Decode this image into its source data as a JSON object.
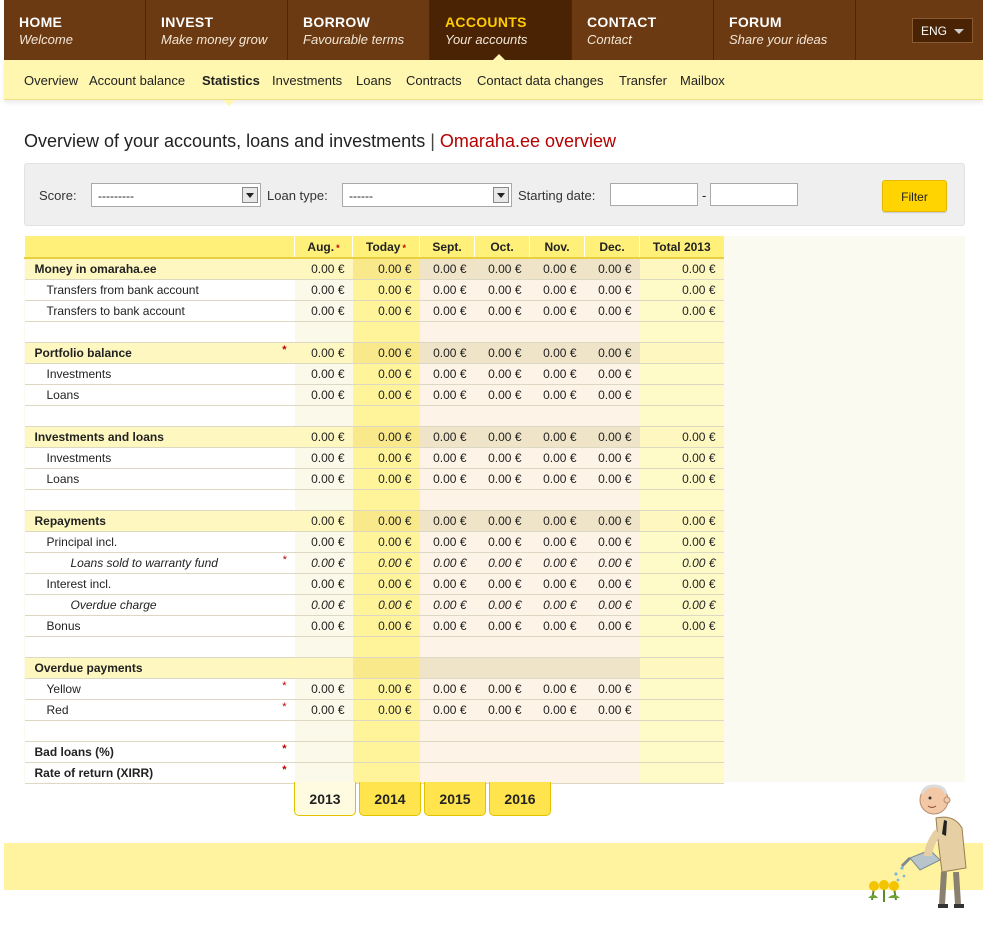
{
  "topnav": [
    {
      "title": "HOME",
      "subtitle": "Welcome"
    },
    {
      "title": "INVEST",
      "subtitle": "Make money grow"
    },
    {
      "title": "BORROW",
      "subtitle": "Favourable terms"
    },
    {
      "title": "ACCOUNTS",
      "subtitle": "Your accounts"
    },
    {
      "title": "CONTACT",
      "subtitle": "Contact"
    },
    {
      "title": "FORUM",
      "subtitle": "Share your ideas"
    }
  ],
  "language": "ENG",
  "subnav": [
    "Overview",
    "Account balance",
    "Statistics",
    "Investments",
    "Loans",
    "Contracts",
    "Contact data changes",
    "Transfer",
    "Mailbox"
  ],
  "page": {
    "title": "Overview of your accounts, loans and investments",
    "separator": "|",
    "brand": "Omaraha.ee overview"
  },
  "filter": {
    "score_label": "Score:",
    "score_value": "---------",
    "loan_type_label": "Loan type:",
    "loan_type_value": "------",
    "start_label": "Starting date:",
    "date_from": "",
    "date_to": "",
    "dash": "-",
    "button": "Filter"
  },
  "table": {
    "columns": [
      "Aug.",
      "Today",
      "Sept.",
      "Oct.",
      "Nov.",
      "Dec.",
      "Total 2013"
    ],
    "required_mark": "*",
    "rows": [
      {
        "label": "Money in omaraha.ee",
        "kind": "sect",
        "values": [
          "0.00 €",
          "0.00 €",
          "0.00 €",
          "0.00 €",
          "0.00 €",
          "0.00 €",
          "0.00 €"
        ]
      },
      {
        "label": "Transfers from bank account",
        "kind": "sub",
        "values": [
          "0.00 €",
          "0.00 €",
          "0.00 €",
          "0.00 €",
          "0.00 €",
          "0.00 €",
          "0.00 €"
        ]
      },
      {
        "label": "Transfers to bank account",
        "kind": "sub",
        "values": [
          "0.00 €",
          "0.00 €",
          "0.00 €",
          "0.00 €",
          "0.00 €",
          "0.00 €",
          "0.00 €"
        ]
      },
      {
        "label": "",
        "kind": "blank",
        "values": [
          "",
          "",
          "",
          "",
          "",
          "",
          ""
        ]
      },
      {
        "label": "Portfolio balance",
        "kind": "sect",
        "req": "*",
        "values": [
          "0.00 €",
          "0.00 €",
          "0.00 €",
          "0.00 €",
          "0.00 €",
          "0.00 €",
          ""
        ]
      },
      {
        "label": "Investments",
        "kind": "sub",
        "values": [
          "0.00 €",
          "0.00 €",
          "0.00 €",
          "0.00 €",
          "0.00 €",
          "0.00 €",
          ""
        ]
      },
      {
        "label": "Loans",
        "kind": "sub",
        "values": [
          "0.00 €",
          "0.00 €",
          "0.00 €",
          "0.00 €",
          "0.00 €",
          "0.00 €",
          ""
        ]
      },
      {
        "label": "",
        "kind": "blank",
        "values": [
          "",
          "",
          "",
          "",
          "",
          "",
          ""
        ]
      },
      {
        "label": "Investments and loans",
        "kind": "sect",
        "values": [
          "0.00 €",
          "0.00 €",
          "0.00 €",
          "0.00 €",
          "0.00 €",
          "0.00 €",
          "0.00 €"
        ]
      },
      {
        "label": "Investments",
        "kind": "sub",
        "values": [
          "0.00 €",
          "0.00 €",
          "0.00 €",
          "0.00 €",
          "0.00 €",
          "0.00 €",
          "0.00 €"
        ]
      },
      {
        "label": "Loans",
        "kind": "sub",
        "values": [
          "0.00 €",
          "0.00 €",
          "0.00 €",
          "0.00 €",
          "0.00 €",
          "0.00 €",
          "0.00 €"
        ]
      },
      {
        "label": "",
        "kind": "blank",
        "values": [
          "",
          "",
          "",
          "",
          "",
          "",
          ""
        ]
      },
      {
        "label": "Repayments",
        "kind": "sect",
        "values": [
          "0.00 €",
          "0.00 €",
          "0.00 €",
          "0.00 €",
          "0.00 €",
          "0.00 €",
          "0.00 €"
        ]
      },
      {
        "label": "Principal incl.",
        "kind": "sub",
        "values": [
          "0.00 €",
          "0.00 €",
          "0.00 €",
          "0.00 €",
          "0.00 €",
          "0.00 €",
          "0.00 €"
        ]
      },
      {
        "label": "Loans sold to warranty fund",
        "kind": "subsub",
        "req": "*",
        "values": [
          "0.00 €",
          "0.00 €",
          "0.00 €",
          "0.00 €",
          "0.00 €",
          "0.00 €",
          "0.00 €"
        ]
      },
      {
        "label": "Interest incl.",
        "kind": "sub",
        "values": [
          "0.00 €",
          "0.00 €",
          "0.00 €",
          "0.00 €",
          "0.00 €",
          "0.00 €",
          "0.00 €"
        ]
      },
      {
        "label": "Overdue charge",
        "kind": "subsub",
        "values": [
          "0.00 €",
          "0.00 €",
          "0.00 €",
          "0.00 €",
          "0.00 €",
          "0.00 €",
          "0.00 €"
        ]
      },
      {
        "label": "Bonus",
        "kind": "sub",
        "values": [
          "0.00 €",
          "0.00 €",
          "0.00 €",
          "0.00 €",
          "0.00 €",
          "0.00 €",
          "0.00 €"
        ]
      },
      {
        "label": "",
        "kind": "blank",
        "values": [
          "",
          "",
          "",
          "",
          "",
          "",
          ""
        ]
      },
      {
        "label": "Overdue payments",
        "kind": "sect",
        "values": [
          "",
          "",
          "",
          "",
          "",
          "",
          ""
        ]
      },
      {
        "label": "Yellow",
        "kind": "sub",
        "req": "*",
        "values": [
          "0.00 €",
          "0.00 €",
          "0.00 €",
          "0.00 €",
          "0.00 €",
          "0.00 €",
          ""
        ]
      },
      {
        "label": "Red",
        "kind": "sub",
        "req": "*",
        "values": [
          "0.00 €",
          "0.00 €",
          "0.00 €",
          "0.00 €",
          "0.00 €",
          "0.00 €",
          ""
        ]
      },
      {
        "label": "",
        "kind": "blank",
        "values": [
          "",
          "",
          "",
          "",
          "",
          "",
          ""
        ]
      },
      {
        "label": "Bad loans (%)",
        "kind": "bold",
        "req": "*",
        "values": [
          "",
          "",
          "",
          "",
          "",
          "",
          ""
        ]
      },
      {
        "label": "Rate of return (XIRR)",
        "kind": "bold",
        "req": "*",
        "values": [
          "",
          "",
          "",
          "",
          "",
          "",
          ""
        ]
      }
    ]
  },
  "years": [
    "2013",
    "2014",
    "2015",
    "2016"
  ],
  "active_year": "2013",
  "colors": {
    "brown": "#6b3a12",
    "accent": "#ffcc00",
    "brand_red": "#b40000",
    "yellow_band": "#fff6b0"
  }
}
